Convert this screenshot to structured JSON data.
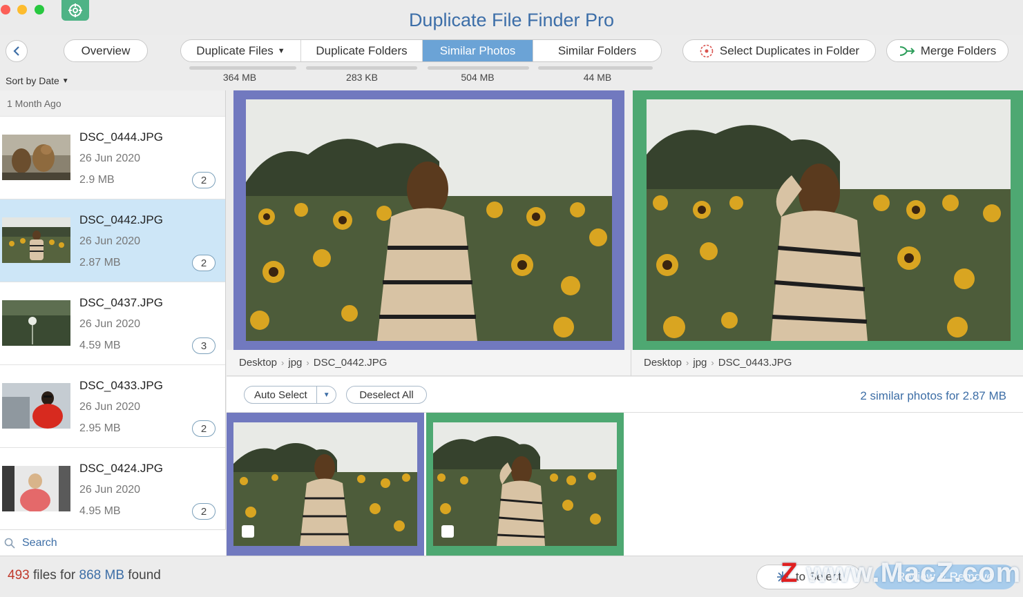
{
  "app": {
    "title": "Duplicate File Finder Pro"
  },
  "toolbar": {
    "overview": "Overview",
    "tabs": [
      {
        "label": "Duplicate Files",
        "size": "364 MB",
        "active": false,
        "dropdown": true
      },
      {
        "label": "Duplicate Folders",
        "size": "283 KB",
        "active": false
      },
      {
        "label": "Similar Photos",
        "size": "504 MB",
        "active": true
      },
      {
        "label": "Similar Folders",
        "size": "44 MB",
        "active": false
      }
    ],
    "select_in_folder": "Select Duplicates in Folder",
    "merge_folders": "Merge Folders"
  },
  "sort": {
    "label": "Sort by Date"
  },
  "sidebar": {
    "group": "1 Month Ago",
    "items": [
      {
        "name": "DSC_0444.JPG",
        "date": "26 Jun 2020",
        "size": "2.9 MB",
        "count": "2",
        "selected": false
      },
      {
        "name": "DSC_0442.JPG",
        "date": "26 Jun 2020",
        "size": "2.87 MB",
        "count": "2",
        "selected": true
      },
      {
        "name": "DSC_0437.JPG",
        "date": "26 Jun 2020",
        "size": "4.59 MB",
        "count": "3",
        "selected": false
      },
      {
        "name": "DSC_0433.JPG",
        "date": "26 Jun 2020",
        "size": "2.95 MB",
        "count": "2",
        "selected": false
      },
      {
        "name": "DSC_0424.JPG",
        "date": "26 Jun 2020",
        "size": "4.95 MB",
        "count": "2",
        "selected": false
      }
    ],
    "search_label": "Search"
  },
  "preview": {
    "left_path": [
      "Desktop",
      "jpg",
      "DSC_0442.JPG"
    ],
    "right_path": [
      "Desktop",
      "jpg",
      "DSC_0443.JPG"
    ]
  },
  "actions": {
    "auto_select": "Auto Select",
    "deselect_all": "Deselect All",
    "summary": "2 similar photos for 2.87 MB"
  },
  "footer": {
    "count": "493",
    "files_for": "files for",
    "size": "868 MB",
    "found": "found",
    "to_select": "to Select",
    "review": "Review & Remove"
  },
  "watermark": {
    "z": "Z",
    "text": "www.MacZ.com"
  },
  "colors": {
    "accent": "#6ba3d6",
    "left_frame": "#7179bf",
    "right_frame": "#4ea872",
    "title": "#3c6ea8"
  }
}
